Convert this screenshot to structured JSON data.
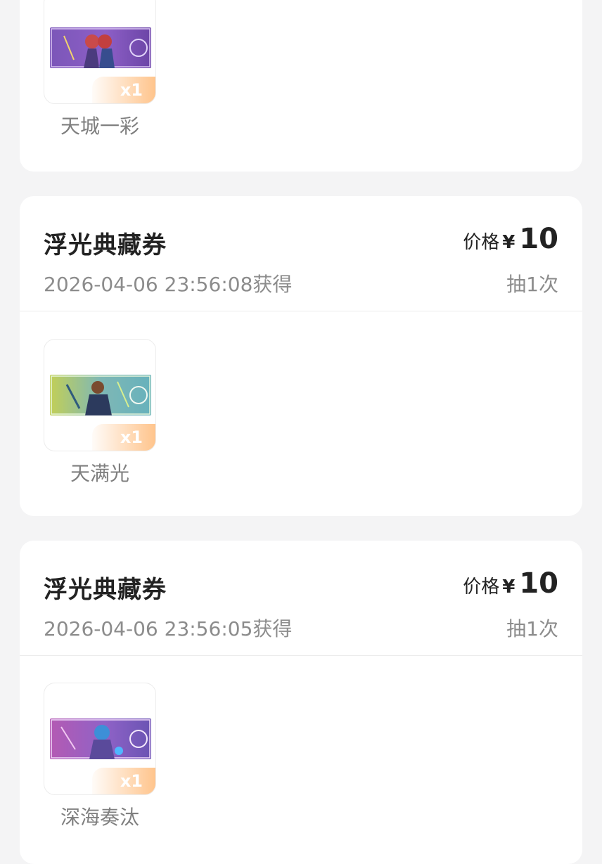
{
  "colors": {
    "page_bg": "#f4f4f5",
    "card_bg": "#ffffff",
    "title_text": "#222222",
    "meta_text": "#8c8c8c",
    "item_text": "#7f7f7f",
    "badge_orange": "#ffba78"
  },
  "cards": [
    {
      "items": [
        {
          "name": "天城一彩",
          "quantity": "x1",
          "art_theme": "purple"
        }
      ]
    },
    {
      "title": "浮光典藏券",
      "price_label": "价格",
      "currency_symbol": "¥",
      "price_value": "10",
      "time_text": "2026-04-06 23:56:08获得",
      "draw_text": "抽1次",
      "items": [
        {
          "name": "天满光",
          "quantity": "x1",
          "art_theme": "green-teal"
        }
      ]
    },
    {
      "title": "浮光典藏券",
      "price_label": "价格",
      "currency_symbol": "¥",
      "price_value": "10",
      "time_text": "2026-04-06 23:56:05获得",
      "draw_text": "抽1次",
      "items": [
        {
          "name": "深海奏汰",
          "quantity": "x1",
          "art_theme": "pink-blue"
        }
      ]
    }
  ]
}
